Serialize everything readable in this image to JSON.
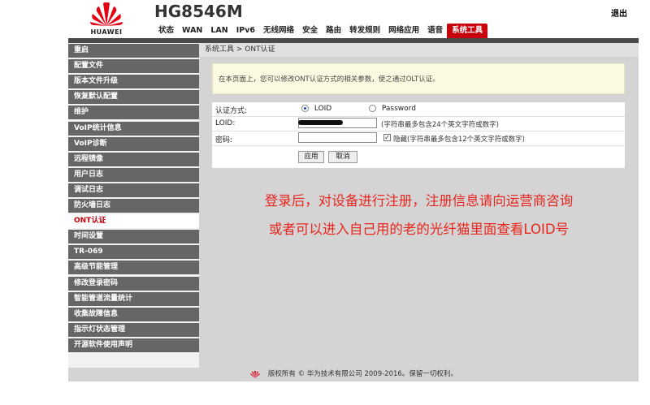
{
  "brand": {
    "logo_text": "HUAWEI",
    "model": "HG8546M",
    "logout": "退出"
  },
  "nav": [
    "状态",
    "WAN",
    "LAN",
    "IPv6",
    "无线网络",
    "安全",
    "路由",
    "转发规则",
    "网络应用",
    "语音",
    "系统工具"
  ],
  "nav_active": "系统工具",
  "sidebar": [
    "重启",
    "配置文件",
    "版本文件升级",
    "恢复默认配置",
    "维护",
    "VoIP统计信息",
    "VoIP诊断",
    "远程镜像",
    "用户日志",
    "调试日志",
    "防火墙日志",
    "ONT认证",
    "时间设置",
    "TR-069",
    "高级节能管理",
    "修改登录密码",
    "智能管道流量统计",
    "收集故障信息",
    "指示灯状态管理",
    "开源软件使用声明"
  ],
  "sidebar_active": "ONT认证",
  "breadcrumb": "系统工具 > ONT认证",
  "info": "在本页面上，您可以修改ONT认证方式的相关参数，使之通过OLT认证。",
  "form": {
    "auth_label": "认证方式:",
    "opt_loid": "LOID",
    "opt_password": "Password",
    "loid_label": "LOID:",
    "loid_hint": "(字符串最多包含24个英文字符或数字)",
    "pwd_label": "密码:",
    "hide_label": "隐藏(字符串最多包含12个英文字符或数字)",
    "apply": "应用",
    "cancel": "取消"
  },
  "annotation": [
    "登录后，对设备进行注册，注册信息请向运营商咨询",
    "或者可以进入自己用的老的光纤猫里面查看LOID号"
  ],
  "footer": "版权所有 © 华为技术有限公司 2009-2016。保留一切权利。",
  "colors": {
    "accent": "#c7000b",
    "annotation": "#e8261d"
  }
}
